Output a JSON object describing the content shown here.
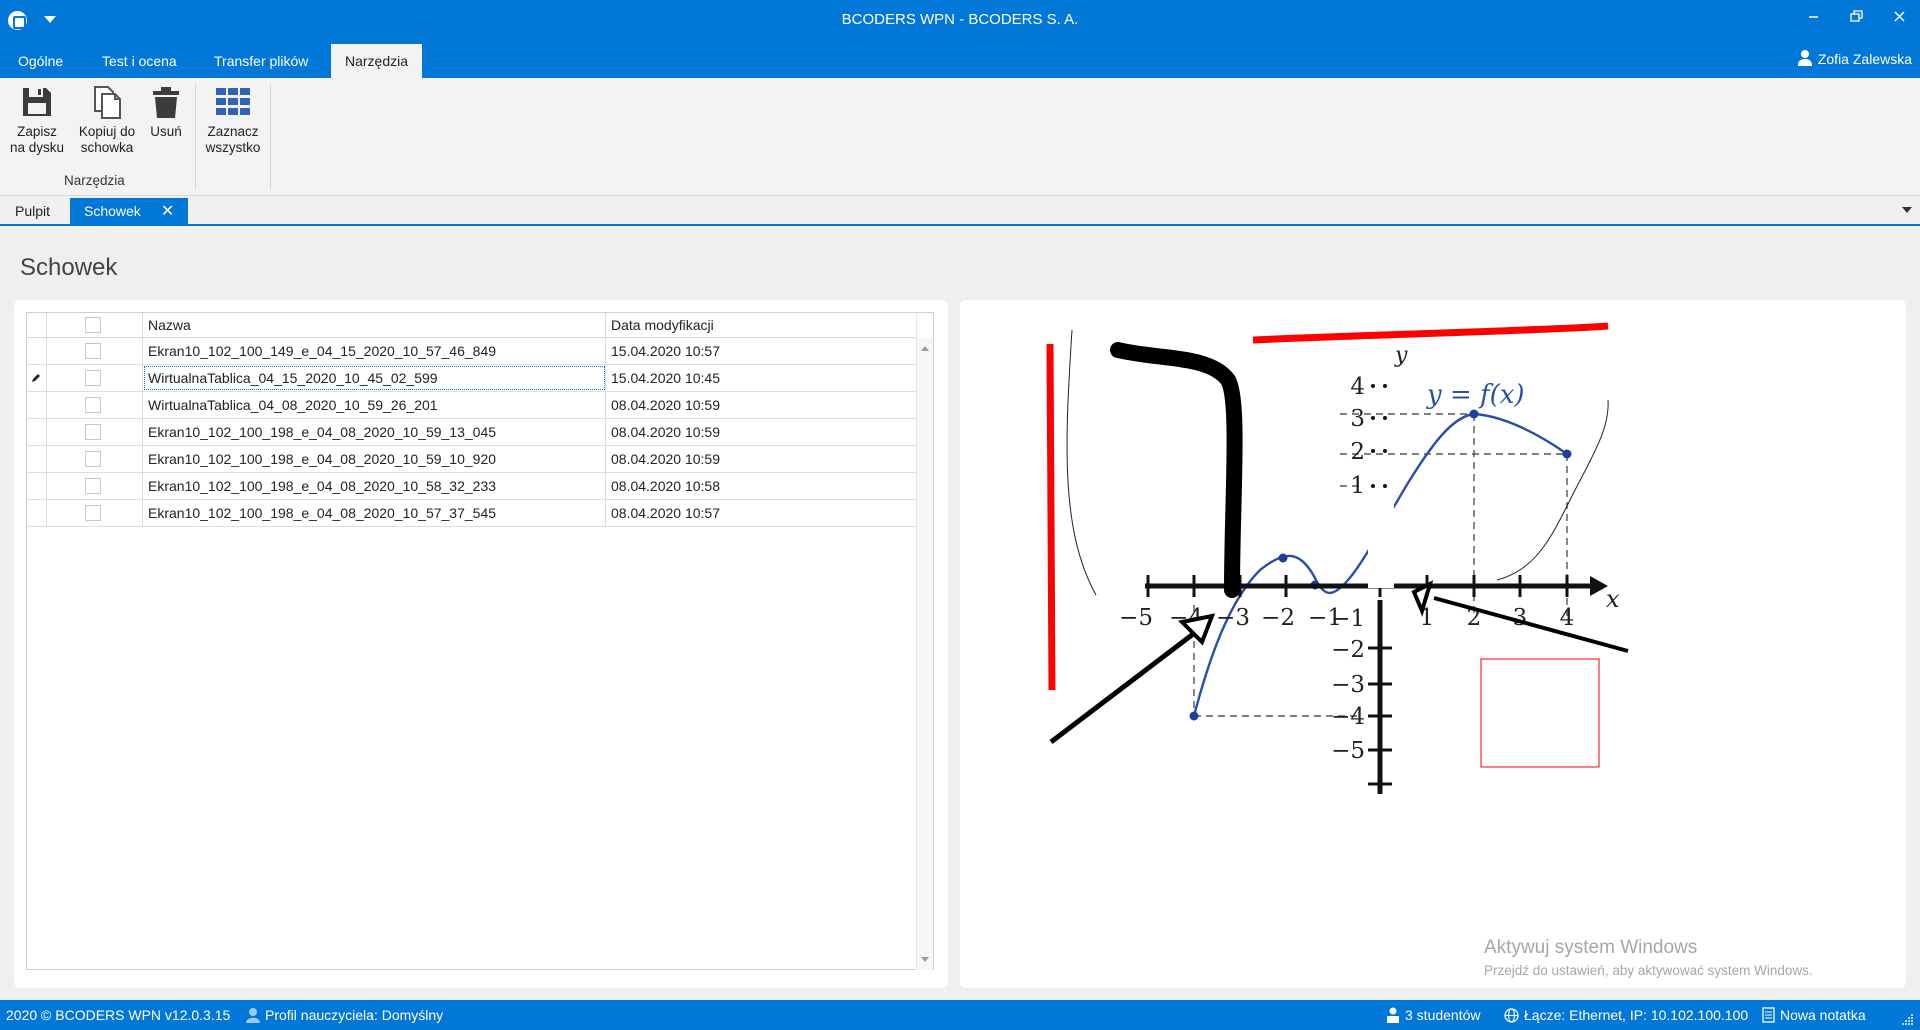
{
  "window": {
    "title": "BCODERS WPN - BCODERS S. A."
  },
  "ribbon_tabs": [
    {
      "label": "Ogólne",
      "active": false
    },
    {
      "label": "Test i ocena",
      "active": false
    },
    {
      "label": "Transfer plików",
      "active": false
    },
    {
      "label": "Narzędzia",
      "active": true
    }
  ],
  "user": {
    "name": "Zofia Zalewska"
  },
  "ribbon": {
    "buttons": [
      {
        "label": "Zapisz\nna dysku",
        "icon": "save-icon"
      },
      {
        "label": "Kopiuj do\nschowka",
        "icon": "copy-icon"
      },
      {
        "label": "Usuń",
        "icon": "trash-icon"
      },
      {
        "label": "Zaznacz\nwszystko",
        "icon": "grid-select-icon"
      }
    ],
    "group_label": "Narzędzia"
  },
  "doc_tabs": [
    {
      "label": "Pulpit",
      "active": false
    },
    {
      "label": "Schowek",
      "active": true,
      "close": "✕"
    }
  ],
  "page": {
    "title": "Schowek"
  },
  "grid": {
    "columns": {
      "name": "Nazwa",
      "date": "Data modyfikacji"
    },
    "rows": [
      {
        "name": "Ekran10_102_100_149_e_04_15_2020_10_57_46_849",
        "date": "15.04.2020 10:57",
        "editing": false
      },
      {
        "name": "WirtualnaTablica_04_15_2020_10_45_02_599",
        "date": "15.04.2020 10:45",
        "editing": true
      },
      {
        "name": "WirtualnaTablica_04_08_2020_10_59_26_201",
        "date": "08.04.2020 10:59",
        "editing": false
      },
      {
        "name": "Ekran10_102_100_198_e_04_08_2020_10_59_13_045",
        "date": "08.04.2020 10:59",
        "editing": false
      },
      {
        "name": "Ekran10_102_100_198_e_04_08_2020_10_59_10_920",
        "date": "08.04.2020 10:59",
        "editing": false
      },
      {
        "name": "Ekran10_102_100_198_e_04_08_2020_10_58_32_233",
        "date": "08.04.2020 10:58",
        "editing": false
      },
      {
        "name": "Ekran10_102_100_198_e_04_08_2020_10_57_37_545",
        "date": "08.04.2020 10:57",
        "editing": false
      }
    ]
  },
  "preview": {
    "func_label": "y = f(x)",
    "axis_x": "x",
    "axis_y": "y",
    "x_ticks": [
      "−5",
      "−4",
      "−3",
      "−2",
      "−1",
      "1",
      "2",
      "3",
      "4"
    ],
    "y_ticks": [
      "4",
      "3",
      "2",
      "1",
      "−1",
      "−2",
      "−3",
      "−4",
      "−5"
    ],
    "annotation_colors": {
      "pen_red": "#ff0000",
      "pen_black": "#000000",
      "curve_blue": "#2a4fa8"
    }
  },
  "watermark": {
    "line1": "Aktywuj system Windows",
    "line2": "Przejdź do ustawień, aby aktywować system Windows."
  },
  "statusbar": {
    "copyright": "2020 ©  BCODERS WPN v12.0.3.15",
    "profile": "Profil nauczyciela: Domyślny",
    "students": "3 studentów",
    "connection": "Łącze: Ethernet, IP: 10.102.100.100",
    "note": "Nowa notatka"
  },
  "colors": {
    "accent": "#0177d7"
  }
}
